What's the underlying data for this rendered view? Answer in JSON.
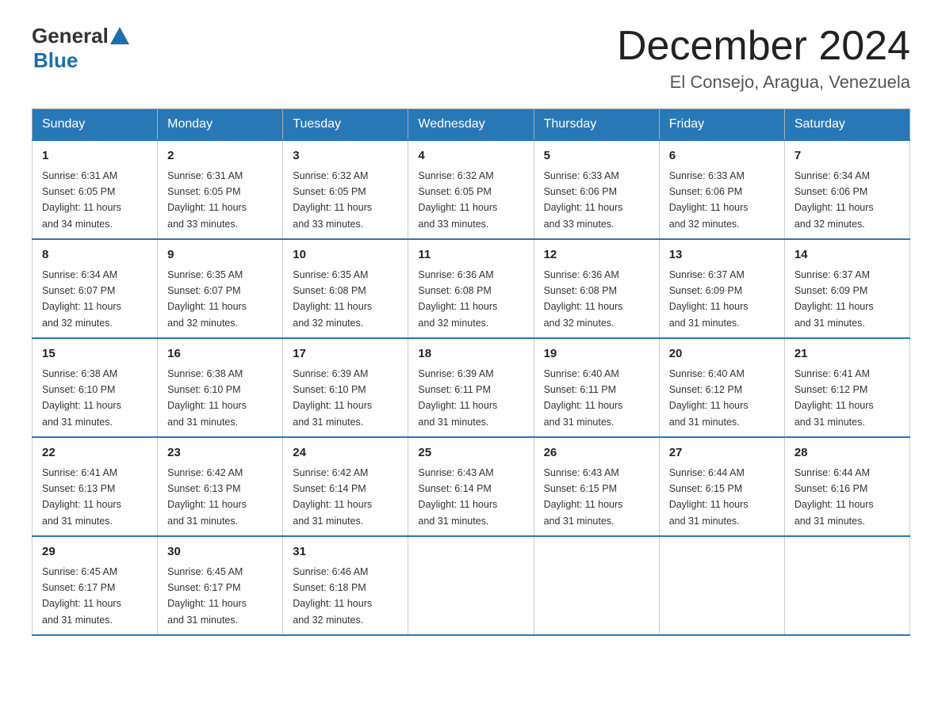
{
  "header": {
    "logo_general": "General",
    "logo_blue": "Blue",
    "month_title": "December 2024",
    "location": "El Consejo, Aragua, Venezuela"
  },
  "weekdays": [
    "Sunday",
    "Monday",
    "Tuesday",
    "Wednesday",
    "Thursday",
    "Friday",
    "Saturday"
  ],
  "weeks": [
    [
      {
        "day": "1",
        "sunrise": "6:31 AM",
        "sunset": "6:05 PM",
        "daylight": "11 hours and 34 minutes."
      },
      {
        "day": "2",
        "sunrise": "6:31 AM",
        "sunset": "6:05 PM",
        "daylight": "11 hours and 33 minutes."
      },
      {
        "day": "3",
        "sunrise": "6:32 AM",
        "sunset": "6:05 PM",
        "daylight": "11 hours and 33 minutes."
      },
      {
        "day": "4",
        "sunrise": "6:32 AM",
        "sunset": "6:05 PM",
        "daylight": "11 hours and 33 minutes."
      },
      {
        "day": "5",
        "sunrise": "6:33 AM",
        "sunset": "6:06 PM",
        "daylight": "11 hours and 33 minutes."
      },
      {
        "day": "6",
        "sunrise": "6:33 AM",
        "sunset": "6:06 PM",
        "daylight": "11 hours and 32 minutes."
      },
      {
        "day": "7",
        "sunrise": "6:34 AM",
        "sunset": "6:06 PM",
        "daylight": "11 hours and 32 minutes."
      }
    ],
    [
      {
        "day": "8",
        "sunrise": "6:34 AM",
        "sunset": "6:07 PM",
        "daylight": "11 hours and 32 minutes."
      },
      {
        "day": "9",
        "sunrise": "6:35 AM",
        "sunset": "6:07 PM",
        "daylight": "11 hours and 32 minutes."
      },
      {
        "day": "10",
        "sunrise": "6:35 AM",
        "sunset": "6:08 PM",
        "daylight": "11 hours and 32 minutes."
      },
      {
        "day": "11",
        "sunrise": "6:36 AM",
        "sunset": "6:08 PM",
        "daylight": "11 hours and 32 minutes."
      },
      {
        "day": "12",
        "sunrise": "6:36 AM",
        "sunset": "6:08 PM",
        "daylight": "11 hours and 32 minutes."
      },
      {
        "day": "13",
        "sunrise": "6:37 AM",
        "sunset": "6:09 PM",
        "daylight": "11 hours and 31 minutes."
      },
      {
        "day": "14",
        "sunrise": "6:37 AM",
        "sunset": "6:09 PM",
        "daylight": "11 hours and 31 minutes."
      }
    ],
    [
      {
        "day": "15",
        "sunrise": "6:38 AM",
        "sunset": "6:10 PM",
        "daylight": "11 hours and 31 minutes."
      },
      {
        "day": "16",
        "sunrise": "6:38 AM",
        "sunset": "6:10 PM",
        "daylight": "11 hours and 31 minutes."
      },
      {
        "day": "17",
        "sunrise": "6:39 AM",
        "sunset": "6:10 PM",
        "daylight": "11 hours and 31 minutes."
      },
      {
        "day": "18",
        "sunrise": "6:39 AM",
        "sunset": "6:11 PM",
        "daylight": "11 hours and 31 minutes."
      },
      {
        "day": "19",
        "sunrise": "6:40 AM",
        "sunset": "6:11 PM",
        "daylight": "11 hours and 31 minutes."
      },
      {
        "day": "20",
        "sunrise": "6:40 AM",
        "sunset": "6:12 PM",
        "daylight": "11 hours and 31 minutes."
      },
      {
        "day": "21",
        "sunrise": "6:41 AM",
        "sunset": "6:12 PM",
        "daylight": "11 hours and 31 minutes."
      }
    ],
    [
      {
        "day": "22",
        "sunrise": "6:41 AM",
        "sunset": "6:13 PM",
        "daylight": "11 hours and 31 minutes."
      },
      {
        "day": "23",
        "sunrise": "6:42 AM",
        "sunset": "6:13 PM",
        "daylight": "11 hours and 31 minutes."
      },
      {
        "day": "24",
        "sunrise": "6:42 AM",
        "sunset": "6:14 PM",
        "daylight": "11 hours and 31 minutes."
      },
      {
        "day": "25",
        "sunrise": "6:43 AM",
        "sunset": "6:14 PM",
        "daylight": "11 hours and 31 minutes."
      },
      {
        "day": "26",
        "sunrise": "6:43 AM",
        "sunset": "6:15 PM",
        "daylight": "11 hours and 31 minutes."
      },
      {
        "day": "27",
        "sunrise": "6:44 AM",
        "sunset": "6:15 PM",
        "daylight": "11 hours and 31 minutes."
      },
      {
        "day": "28",
        "sunrise": "6:44 AM",
        "sunset": "6:16 PM",
        "daylight": "11 hours and 31 minutes."
      }
    ],
    [
      {
        "day": "29",
        "sunrise": "6:45 AM",
        "sunset": "6:17 PM",
        "daylight": "11 hours and 31 minutes."
      },
      {
        "day": "30",
        "sunrise": "6:45 AM",
        "sunset": "6:17 PM",
        "daylight": "11 hours and 31 minutes."
      },
      {
        "day": "31",
        "sunrise": "6:46 AM",
        "sunset": "6:18 PM",
        "daylight": "11 hours and 32 minutes."
      },
      null,
      null,
      null,
      null
    ]
  ],
  "labels": {
    "sunrise": "Sunrise:",
    "sunset": "Sunset:",
    "daylight": "Daylight:"
  }
}
